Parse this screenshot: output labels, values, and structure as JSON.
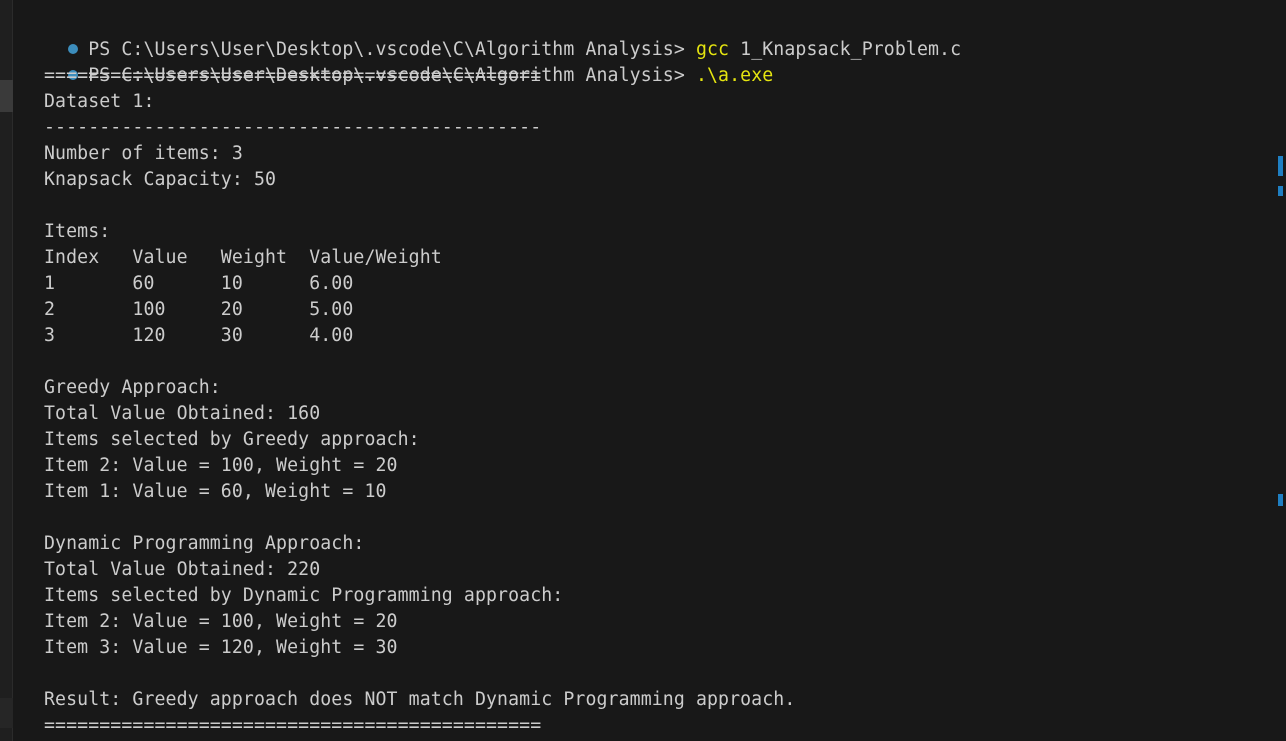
{
  "prompt": {
    "text": "PS C:\\Users\\User\\Desktop\\.vscode\\C\\Algorithm Analysis> "
  },
  "commands": [
    {
      "cmd": "gcc",
      "args": " 1_Knapsack_Problem.c"
    },
    {
      "cmd": ".\\a.exe",
      "args": ""
    }
  ],
  "output": {
    "separator_eq": "=============================================",
    "dataset_label": "Dataset 1:",
    "separator_dash": "---------------------------------------------",
    "num_items": "Number of items: 3",
    "capacity": "Knapsack Capacity: 50",
    "items_label": "Items:",
    "table_header": "Index   Value   Weight  Value/Weight",
    "table_rows": [
      "1       60      10      6.00",
      "2       100     20      5.00",
      "3       120     30      4.00"
    ],
    "greedy_title": "Greedy Approach:",
    "greedy_total": "Total Value Obtained: 160",
    "greedy_selected_label": "Items selected by Greedy approach:",
    "greedy_items": [
      "Item 2: Value = 100, Weight = 20",
      "Item 1: Value = 60, Weight = 10"
    ],
    "dp_title": "Dynamic Programming Approach:",
    "dp_total": "Total Value Obtained: 220",
    "dp_selected_label": "Items selected by Dynamic Programming approach:",
    "dp_items": [
      "Item 2: Value = 100, Weight = 20",
      "Item 3: Value = 120, Weight = 30"
    ],
    "result": "Result: Greedy approach does NOT match Dynamic Programming approach.",
    "separator_eq_end": "============================================="
  },
  "colors": {
    "background": "#181818",
    "text": "#cccccc",
    "command": "#e5e510",
    "prompt_dot": "#3c8dbc",
    "scroll_marker": "#1f7fc2"
  }
}
